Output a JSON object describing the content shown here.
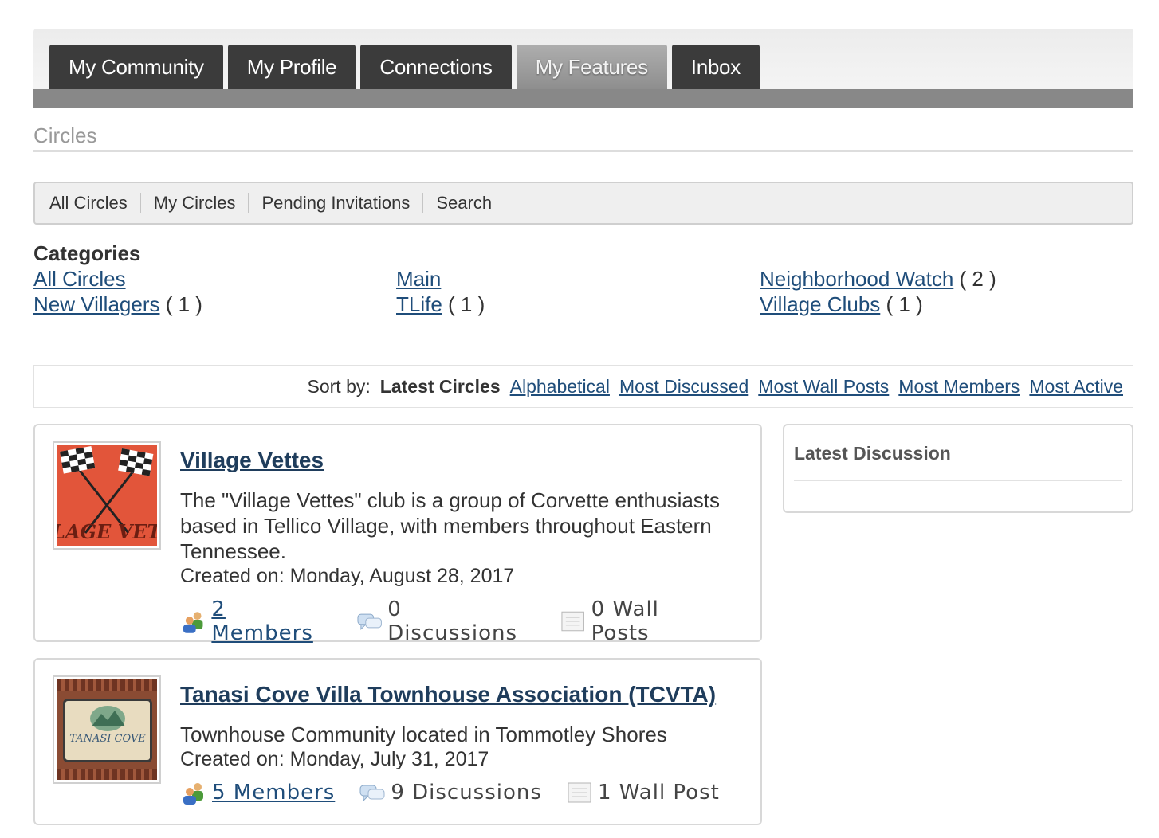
{
  "tabs": [
    {
      "label": "My Community"
    },
    {
      "label": "My Profile"
    },
    {
      "label": "Connections"
    },
    {
      "label": "My Features",
      "active": true
    },
    {
      "label": "Inbox"
    }
  ],
  "section_title": "Circles",
  "subnav": [
    {
      "label": "All Circles"
    },
    {
      "label": "My Circles"
    },
    {
      "label": "Pending Invitations"
    },
    {
      "label": "Search"
    }
  ],
  "categories": {
    "heading": "Categories",
    "items": [
      {
        "label": "All Circles",
        "count": ""
      },
      {
        "label": "Main",
        "count": ""
      },
      {
        "label": "Neighborhood Watch",
        "count": " ( 2 )"
      },
      {
        "label": "New Villagers",
        "count": " ( 1 )"
      },
      {
        "label": "TLife",
        "count": " ( 1 )"
      },
      {
        "label": "Village Clubs",
        "count": " ( 1 )"
      }
    ]
  },
  "sort": {
    "label": "Sort by:",
    "current": "Latest Circles",
    "options": [
      "Alphabetical",
      "Most Discussed",
      "Most Wall Posts",
      "Most Members",
      "Most Active"
    ]
  },
  "circles": [
    {
      "title": "Village Vettes",
      "description": "The \"Village Vettes\" club is a group of Corvette enthusiasts based in Tellico Village, with members throughout Eastern Tennessee.",
      "created": "Created on: Monday, August 28, 2017",
      "members": "2  Members",
      "discussions": "0  Discussions",
      "wall_posts": "0  Wall  Posts",
      "thumb_text": "LAGE VETT",
      "thumb_color": "#e2553a"
    },
    {
      "title": "Tanasi Cove Villa Townhouse Association (TCVTA)",
      "description": "Townhouse Community located in Tommotley Shores",
      "created": "Created on: Monday, July 31, 2017",
      "members": "5  Members",
      "discussions": "9  Discussions",
      "wall_posts": "1  Wall  Post",
      "thumb_text": "TANASI COVE",
      "thumb_color": "#8a4b33"
    }
  ],
  "latest_discussion": {
    "title": "Latest Discussion"
  },
  "colors": {
    "link": "#1f4d7a",
    "tab_bg": "#3b3b3b",
    "tab_active": "#9e9e9e"
  }
}
